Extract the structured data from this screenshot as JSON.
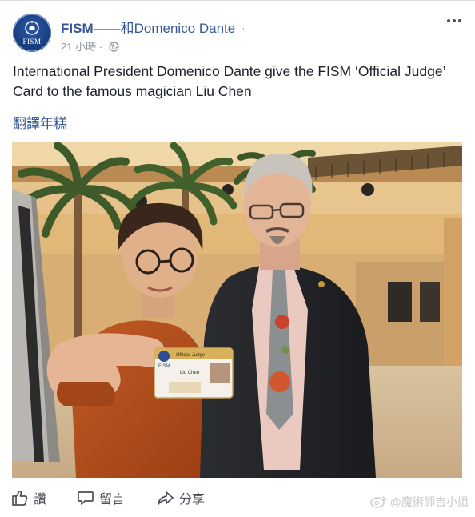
{
  "post": {
    "page_name": "FISM",
    "separator": "——和",
    "with_name": "Domenico Dante",
    "with_marker": "·",
    "timestamp": "21 小時",
    "meta_dot": " · ",
    "text": "International President Domenico Dante give the FISM ‘Official Judge’ Card to the famous magician Liu Chen",
    "translate_label": "翻譯年糕",
    "avatar_label": "FISM"
  },
  "photo": {
    "card_header": "Official Judge",
    "card_logo": "FISM",
    "card_name": "Liu Chen"
  },
  "actions": {
    "like_label": "讚",
    "comment_label": "留言",
    "share_label": "分享"
  },
  "watermark": {
    "text": "@魔術師吉小姐"
  },
  "colors": {
    "link": "#365899",
    "meta": "#90949c",
    "text": "#1d2129",
    "action": "#4b4f56"
  }
}
